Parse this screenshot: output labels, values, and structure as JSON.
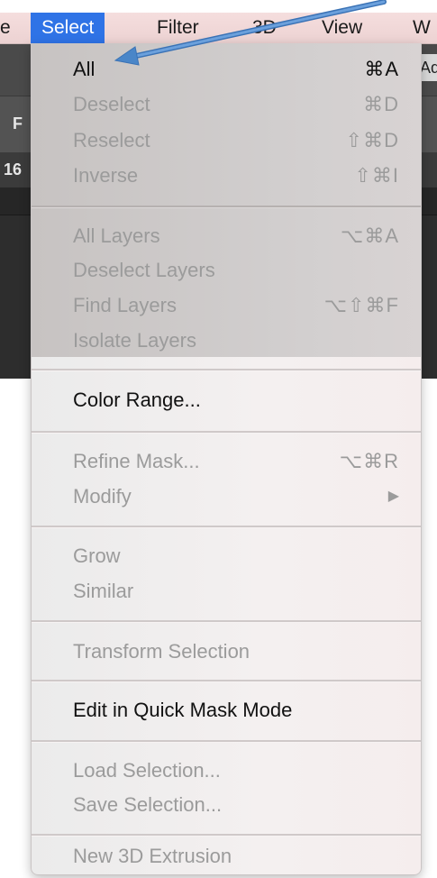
{
  "menubar": {
    "items": [
      {
        "label": "e",
        "active": false
      },
      {
        "label": "Select",
        "active": true
      },
      {
        "label": "Filter",
        "active": false
      },
      {
        "label": "3D",
        "active": false
      },
      {
        "label": "View",
        "active": false
      },
      {
        "label": "W",
        "active": false
      }
    ]
  },
  "background": {
    "left_label_1": "F",
    "left_label_2": "16",
    "right_panel_text": "Ad"
  },
  "menu": {
    "sections": [
      {
        "items": [
          {
            "label": "All",
            "shortcut": "⌘A",
            "enabled": true
          },
          {
            "label": "Deselect",
            "shortcut": "⌘D",
            "enabled": false
          },
          {
            "label": "Reselect",
            "shortcut": "⇧⌘D",
            "enabled": false
          },
          {
            "label": "Inverse",
            "shortcut": "⇧⌘I",
            "enabled": false
          }
        ]
      },
      {
        "items": [
          {
            "label": "All Layers",
            "shortcut": "⌥⌘A",
            "enabled": false
          },
          {
            "label": "Deselect Layers",
            "shortcut": "",
            "enabled": false
          },
          {
            "label": "Find Layers",
            "shortcut": "⌥⇧⌘F",
            "enabled": false
          },
          {
            "label": "Isolate Layers",
            "shortcut": "",
            "enabled": false
          }
        ]
      },
      {
        "items": [
          {
            "label": "Color Range...",
            "shortcut": "",
            "enabled": true
          }
        ]
      },
      {
        "items": [
          {
            "label": "Refine Mask...",
            "shortcut": "⌥⌘R",
            "enabled": false
          },
          {
            "label": "Modify",
            "shortcut": "",
            "enabled": false,
            "submenu": true
          }
        ]
      },
      {
        "items": [
          {
            "label": "Grow",
            "shortcut": "",
            "enabled": false
          },
          {
            "label": "Similar",
            "shortcut": "",
            "enabled": false
          }
        ]
      },
      {
        "items": [
          {
            "label": "Transform Selection",
            "shortcut": "",
            "enabled": false
          }
        ]
      },
      {
        "items": [
          {
            "label": "Edit in Quick Mask Mode",
            "shortcut": "",
            "enabled": true
          }
        ]
      },
      {
        "items": [
          {
            "label": "Load Selection...",
            "shortcut": "",
            "enabled": false
          },
          {
            "label": "Save Selection...",
            "shortcut": "",
            "enabled": false
          }
        ]
      },
      {
        "items": [
          {
            "label": "New 3D Extrusion",
            "shortcut": "",
            "enabled": false
          }
        ]
      }
    ],
    "submenu_arrow": "▶"
  },
  "colors": {
    "menubar_active": "#2f73e6",
    "arrow": "#4a86c8",
    "text_enabled": "#111111",
    "text_disabled": "#9b9b9b"
  },
  "annotation": {
    "icon": "arrow-pointer-icon"
  }
}
